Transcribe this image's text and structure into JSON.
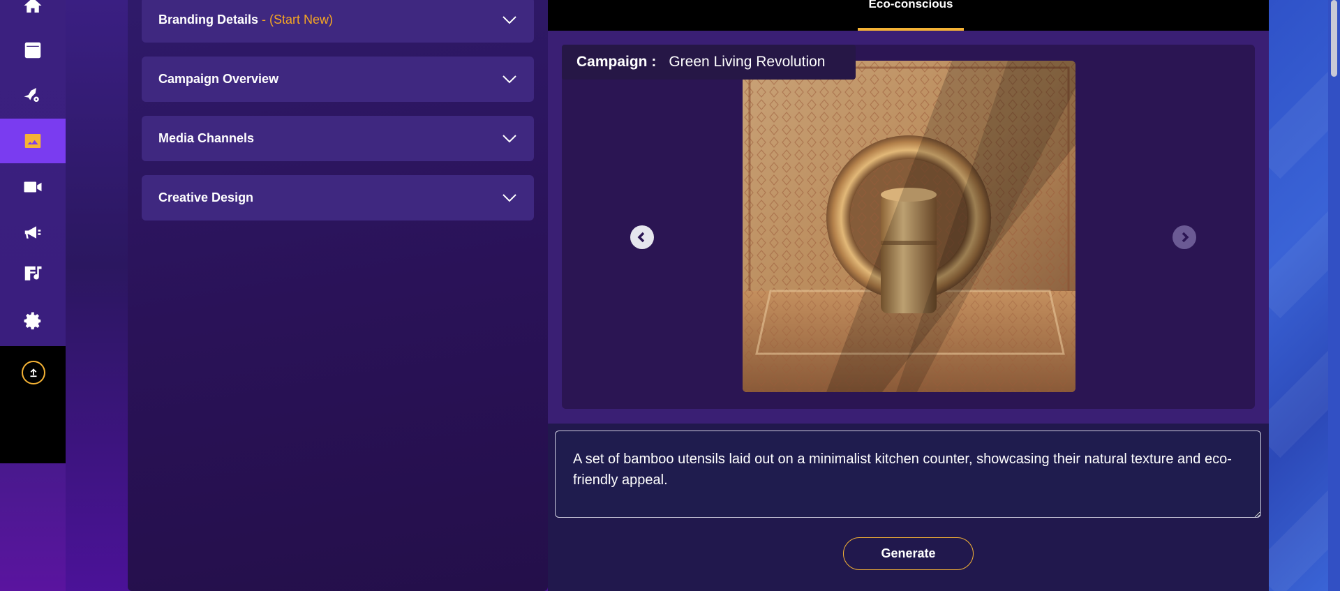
{
  "rail": {
    "items": [
      {
        "icon": "home-icon"
      },
      {
        "icon": "document-icon"
      },
      {
        "icon": "rocket-gear-icon"
      },
      {
        "icon": "image-icon",
        "active": true
      },
      {
        "icon": "video-icon"
      },
      {
        "icon": "megaphone-icon"
      },
      {
        "icon": "music-notes-icon"
      },
      {
        "icon": "gear-icon"
      }
    ],
    "upload_icon": "upload-icon",
    "active_color": "#7a3cf0",
    "accent": "#f5b335"
  },
  "form": {
    "sections": [
      {
        "title": "Branding Details",
        "extra": " - (Start New)"
      },
      {
        "title": "Campaign Overview",
        "extra": ""
      },
      {
        "title": "Media Channels",
        "extra": ""
      },
      {
        "title": "Creative Design",
        "extra": ""
      }
    ]
  },
  "preview": {
    "active_tab": "Eco-conscious",
    "campaign_key": "Campaign :",
    "campaign_name": "Green Living Revolution",
    "prompt_text": "A set of bamboo utensils laid out on a minimalist kitchen counter, showcasing their natural texture and eco-friendly appeal.",
    "generate_label": "Generate"
  }
}
